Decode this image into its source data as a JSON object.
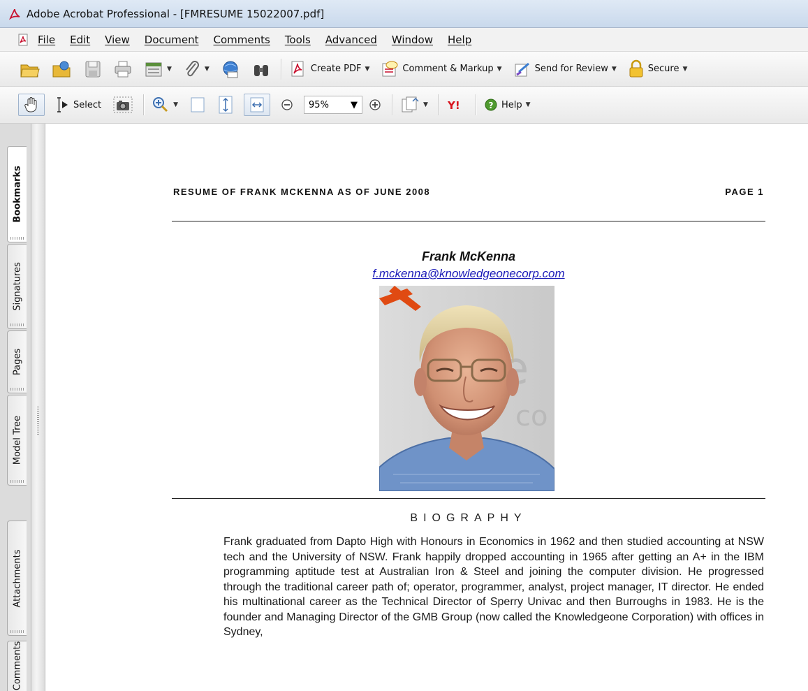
{
  "window": {
    "title": "Adobe Acrobat Professional - [FMRESUME 15022007.pdf]"
  },
  "menu": {
    "items": [
      "File",
      "Edit",
      "View",
      "Document",
      "Comments",
      "Tools",
      "Advanced",
      "Window",
      "Help"
    ]
  },
  "toolbar1": {
    "create_pdf": "Create PDF",
    "comment_markup": "Comment & Markup",
    "send_review": "Send for Review",
    "secure": "Secure"
  },
  "toolbar2": {
    "select": "Select",
    "zoom_value": "95%",
    "help": "Help"
  },
  "navpane": {
    "tabs": [
      "Bookmarks",
      "Signatures",
      "Pages",
      "Model Tree",
      "Attachments",
      "Comments"
    ]
  },
  "document": {
    "running_head_left": "RESUME OF FRANK MCKENNA AS OF JUNE 2008",
    "running_head_right": "PAGE 1",
    "name": "Frank McKenna",
    "email": "f.mckenna@knowledgeonecorp.com",
    "bio_heading": "BIOGRAPHY",
    "bio_text": "Frank graduated from Dapto High with Honours in Economics in 1962 and then studied accounting at NSW tech and the University of NSW. Frank happily dropped accounting in 1965 after getting an A+ in the IBM programming aptitude test at Australian Iron & Steel and joining the computer division. He progressed through the traditional career path of; operator, programmer, analyst, project manager, IT director. He ended his multinational career as the Technical Director of Sperry Univac and then Burroughs in 1983. He is the founder and Managing Director of the GMB Group (now called the Knowledgeone Corporation) with offices in Sydney,"
  },
  "colors": {
    "link": "#1a1ab8",
    "acrobat_red": "#c8102e"
  }
}
